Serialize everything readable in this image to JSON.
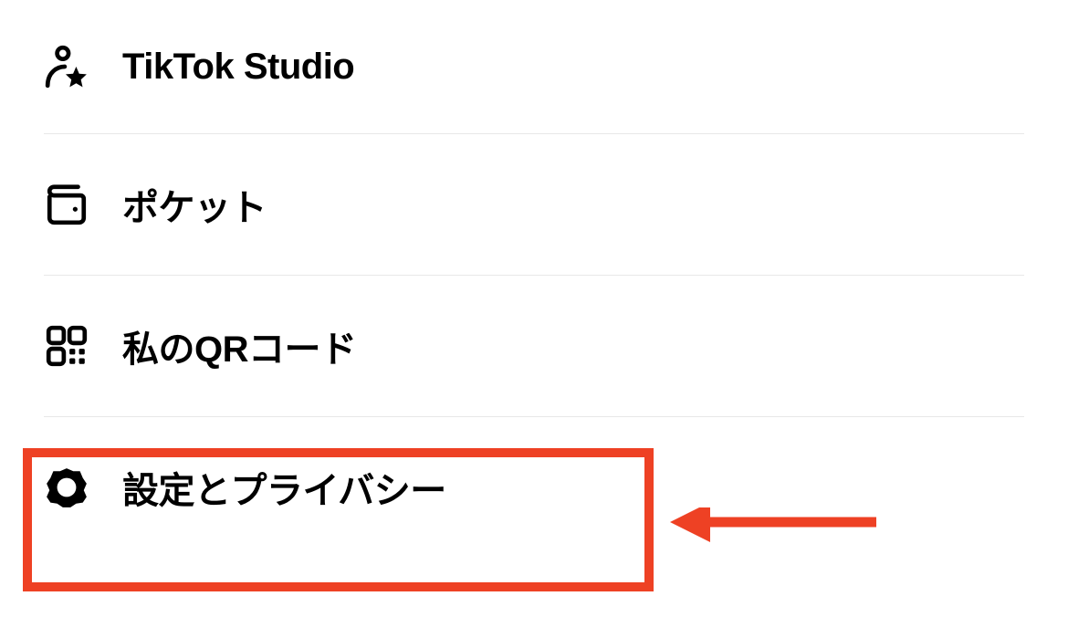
{
  "menu": {
    "items": [
      {
        "label": "TikTok Studio"
      },
      {
        "label": "ポケット"
      },
      {
        "label": "私のQRコード"
      },
      {
        "label": "設定とプライバシー"
      }
    ]
  }
}
